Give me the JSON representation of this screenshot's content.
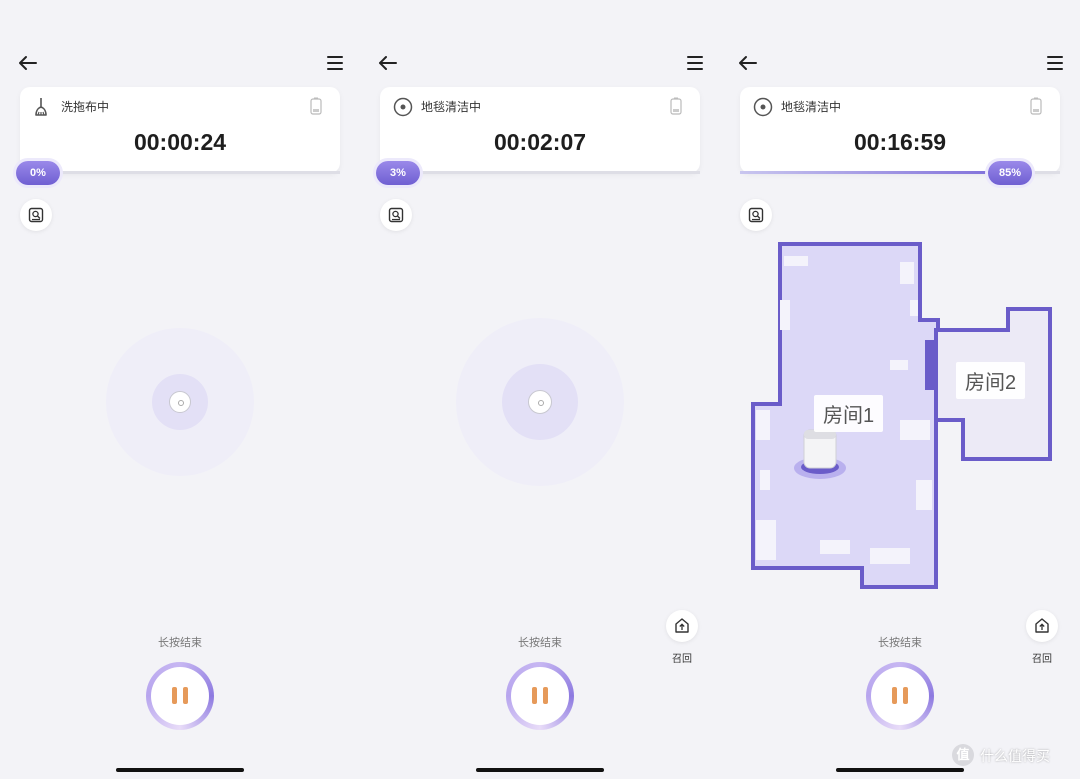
{
  "colors": {
    "accent": "#7c6bd9",
    "pause": "#e69a5a",
    "map_wall": "#6a5cc9",
    "map_floor": "#dcd8f7"
  },
  "panels": [
    {
      "mode_icon": "mop-icon",
      "mode_label": "洗拖布中",
      "timer": "00:00:24",
      "progress_label": "0%",
      "progress": 0,
      "hold_label": "长按结束"
    },
    {
      "mode_icon": "carpet-clean-icon",
      "mode_label": "地毯清洁中",
      "timer": "00:02:07",
      "progress_label": "3%",
      "progress": 0.03,
      "hold_label": "长按结束",
      "recall_label": "召回"
    },
    {
      "mode_icon": "carpet-clean-icon",
      "mode_label": "地毯清洁中",
      "timer": "00:16:59",
      "progress_label": "85%",
      "progress": 0.85,
      "hold_label": "长按结束",
      "recall_label": "召回",
      "map": {
        "rooms": [
          "房间1",
          "房间2"
        ]
      }
    }
  ],
  "watermark": {
    "logo": "值",
    "text": "什么值得买"
  }
}
